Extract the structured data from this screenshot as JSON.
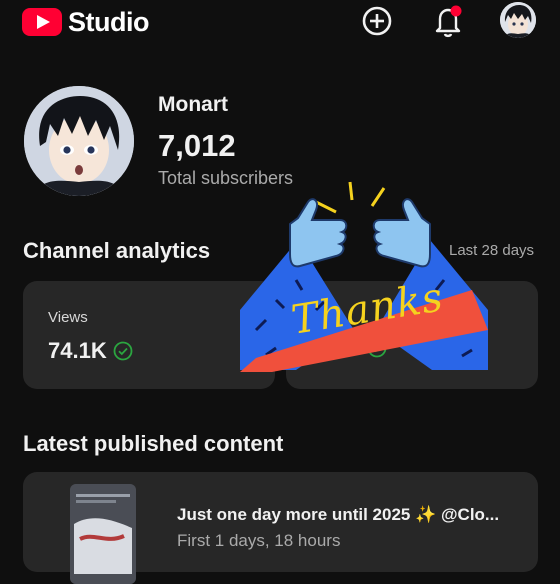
{
  "header": {
    "brand": "Studio",
    "icons": [
      "youtube-logo-icon",
      "create-plus-icon",
      "notification-bell-icon",
      "account-avatar"
    ]
  },
  "channel": {
    "name": "Monart",
    "subscribers": "7,012",
    "subscribers_label": "Total subscribers"
  },
  "analytics": {
    "title": "Channel analytics",
    "period": "Last 28 days",
    "cards": [
      {
        "label": "Views",
        "value": "74.1K"
      },
      {
        "label": "",
        "value": ""
      }
    ]
  },
  "sticker": {
    "text": "Thanks"
  },
  "latest": {
    "title": "Latest published content",
    "video_title": "Just one day more until 2025 ✨ @Clo...",
    "video_stats": "First 1 days, 18 hours"
  },
  "colors": {
    "background": "#0f0f0f",
    "card": "#272727",
    "accent_red": "#ff0033",
    "check_green": "#2ba640"
  }
}
